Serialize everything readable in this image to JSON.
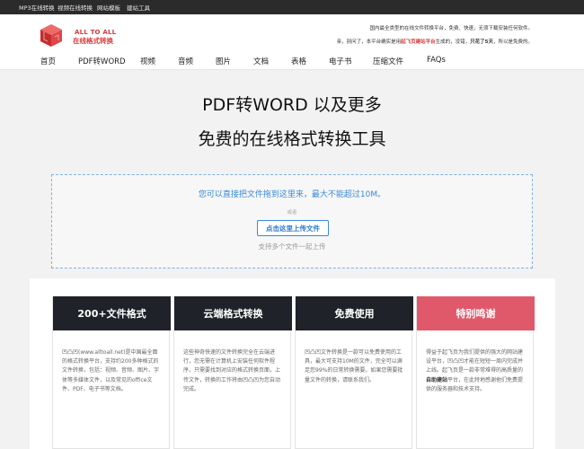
{
  "topbar": {
    "links": [
      "MP3在线转换",
      "视频在线转换",
      "网站模板",
      "建站工具"
    ]
  },
  "header": {
    "logo_en": "ALL TO ALL",
    "logo_cn": "在线格式转换",
    "slogan_line1": "国内最全类型的在线文件转换平台，免费、快速，无须下载安装任何软件。",
    "slogan_line2_a": "亲，别问了，本平台确实是用",
    "slogan_line2_red": "起飞页建站平台",
    "slogan_line2_b": "生成的，没错，",
    "slogan_line2_bold": "只花了5天",
    "slogan_line2_c": "，所以是免费的。"
  },
  "nav": {
    "items": [
      "首页",
      "PDF转WORD",
      "视频",
      "音频",
      "图片",
      "文档",
      "表格",
      "电子书",
      "压缩文件",
      "FAQs"
    ]
  },
  "hero": {
    "title_line1": "PDF转WORD 以及更多",
    "title_line2": "免费的在线格式转换工具"
  },
  "upload": {
    "main_text": "您可以直接把文件拖到这里来，最大不能超过10M。",
    "or_text": "或者",
    "button_label": "点击这里上传文件",
    "sub_text": "支持多个文件一起上传"
  },
  "features": [
    {
      "title": "200+文件格式",
      "text": "凹凸凹(www.alltoall.net)是中国最全面的格式转换平台，支持约200多种格式的文件转换，包括：视频、音频、图片、字体等多媒体文件，以及常见的office文件、PDF、电子书等文档。"
    },
    {
      "title": "云端格式转换",
      "text": "这些神奇快速的文件转换完全在云端进行，您无需在计算机上安装任何软件程序，只需要找到对应的格式转换页面，上传文件，转换的工作将由凹凸凹为您自动完成。"
    },
    {
      "title": "免费使用",
      "text": "凹凸凹文件转换是一款可以免费使用的工具，最大可支持10M的文件，完全可以满足您99%的日常转换需要。如果您需要批量文件的转换，请联系我们。"
    },
    {
      "title": "特别鸣谢",
      "text_a": "得益于起飞页为我们提供的强大的网站建设平台，凹凸凹才能在短短一周内完成并上线。起飞页是一款非常难得的高质量的",
      "text_bold": "自助建站",
      "text_b": "平台，在此特地感谢他们免费提供的服务器和技术支持。"
    }
  ],
  "colors": {
    "dark_card": "#1f2229",
    "accent_card": "#e0596b",
    "link_blue": "#3a8ad8",
    "logo_red": "#d83a3a"
  }
}
